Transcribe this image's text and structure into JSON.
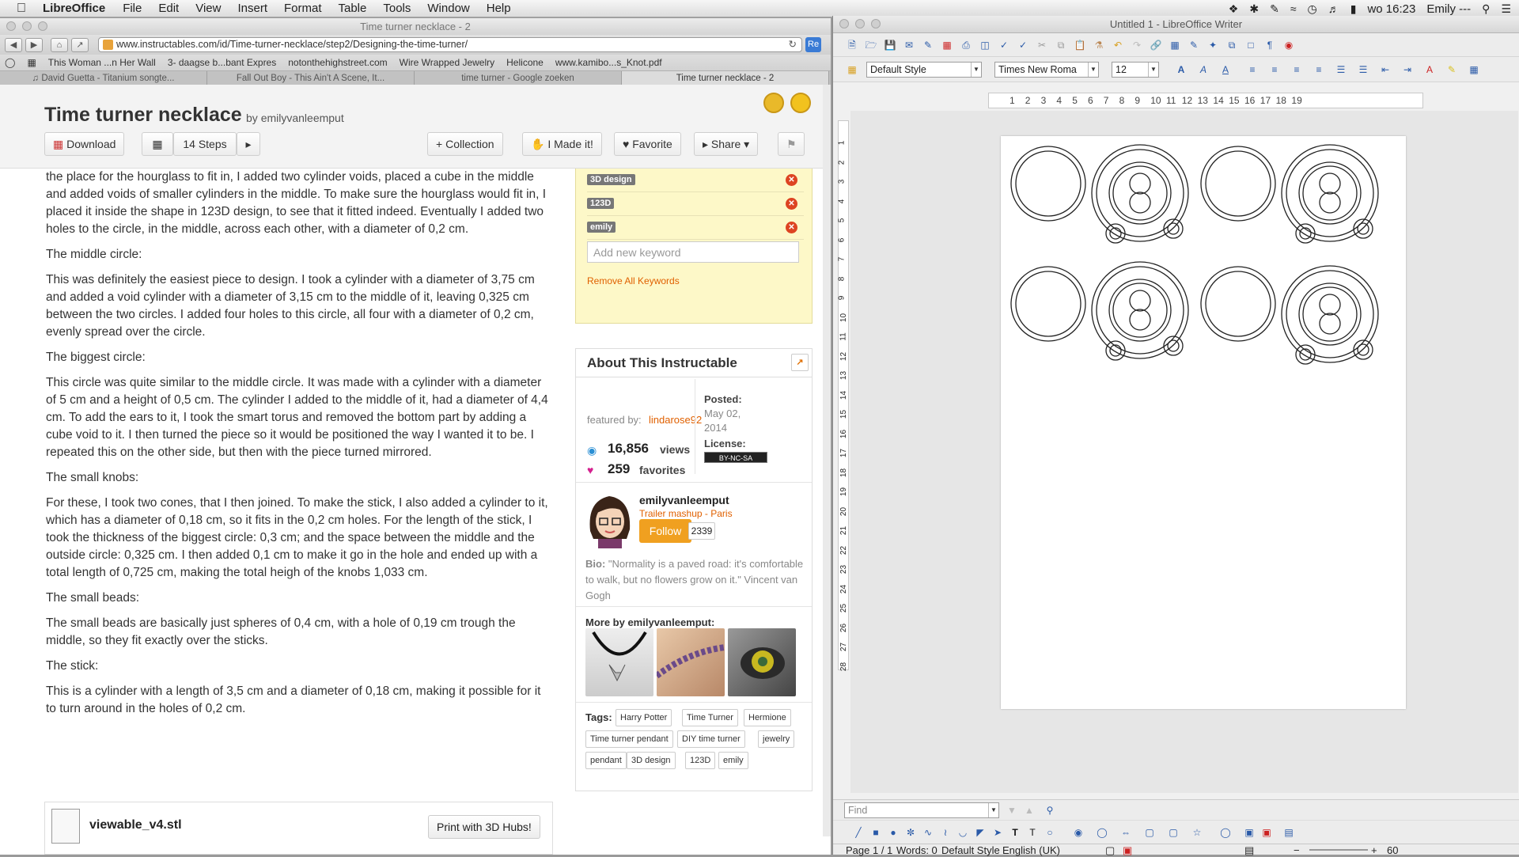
{
  "menubar": {
    "app": "LibreOffice",
    "items": [
      "File",
      "Edit",
      "View",
      "Insert",
      "Format",
      "Table",
      "Tools",
      "Window",
      "Help"
    ],
    "clock": "wo 16:23",
    "user": "Emily ---"
  },
  "browser": {
    "title": "Time turner necklace - 2",
    "url": "www.instructables.com/id/Time-turner-necklace/step2/Designing-the-time-turner/",
    "url_tail": "Re",
    "bookmarks": [
      "This Woman ...n Her Wall",
      "3- daagse b...bant Expres",
      "notonthehighstreet.com",
      "Wire Wrapped Jewelry",
      "Helicone",
      "www.kamibo...s_Knot.pdf"
    ],
    "tabs": [
      "David Guetta - Titanium songte...",
      "Fall Out Boy - This Ain't A Scene, It...",
      "time turner - Google zoeken",
      "Time turner necklace - 2"
    ]
  },
  "header": {
    "title": "Time turner necklace",
    "byline_prefix": "by",
    "author": "emilyvanleemput",
    "download": "Download",
    "steps": "14 Steps",
    "collection": "Collection",
    "made_it": "I Made it!",
    "favorite": "Favorite",
    "share": "Share"
  },
  "article": {
    "p1": "the place for the hourglass to fit in, I added two cylinder voids, placed a cube in the middle and added voids of smaller cylinders in the middle. To make sure the hourglass would fit in, I placed it inside the shape in 123D design, to see that it fitted indeed. Eventually I added two holes to the circle, in the middle, across each other, with a diameter of 0,2 cm.",
    "h2": "The middle circle:",
    "p2": "This was definitely the easiest piece to design. I took a cylinder with a diameter of 3,75 cm and added a void cylinder with a diameter of 3,15 cm to the middle of it, leaving 0,325 cm between the two circles. I added four holes to this circle, all four with a diameter of 0,2 cm, evenly spread over the circle.",
    "h3": "The biggest circle:",
    "p3": "This circle was quite similar to the middle circle. It was made with a cylinder with a diameter of 5 cm and a height of 0,5 cm. The cylinder I added to the middle of it, had a diameter of 4,4 cm. To add the ears to it, I took the smart torus and removed the bottom part by adding a cube void to it. I then turned the piece so it would be positioned the way I wanted it to be. I repeated this on the other side, but then with the piece turned mirrored.",
    "h4": "The small knobs:",
    "p4": "For these, I took two cones, that I then joined. To make the stick, I also added a cylinder to it, which has a diameter of 0,18 cm, so it fits in the 0,2 cm holes. For the length of the stick, I took the thickness of the biggest circle: 0,3 cm; and the space between the middle and the outside circle: 0,325 cm. I then added 0,1 cm to make it go in the hole and ended up with a total length of 0,725 cm, making the total heigh of the knobs 1,033 cm.",
    "h5": "The small beads:",
    "p5": "The small beads are basically just spheres of 0,4 cm, with a hole of 0,19 cm trough the middle, so they fit exactly over the sticks.",
    "h6": "The stick:",
    "p6": "This is a cylinder with a length of 3,5 cm and a diameter of 0,18 cm, making it possible for it to turn around in the holes of 0,2 cm."
  },
  "keywords": {
    "tags": [
      "3D design",
      "123D",
      "emily"
    ],
    "placeholder": "Add new keyword",
    "remove_all": "Remove All Keywords"
  },
  "about": {
    "title": "About This Instructable",
    "featured_label": "featured by:",
    "featured_by": "lindarose92",
    "posted_label": "Posted:",
    "posted_date_1": "May 02,",
    "posted_date_2": "2014",
    "license_label": "License:",
    "license_badge": "BY-NC-SA",
    "views": "16,856",
    "views_label": "views",
    "favorites": "259",
    "favorites_label": "favorites",
    "author": "emilyvanleemput",
    "author_sub": "Trailer mashup - Paris",
    "follow": "Follow",
    "followers": "2339",
    "bio_label": "Bio:",
    "bio": "\"Normality is a paved road: it's comfortable to walk, but no flowers grow on it.\" Vincent van Gogh",
    "more_by": "More by emilyvanleemput:",
    "tags_label": "Tags:",
    "tags": [
      "Harry Potter",
      "Time Turner",
      "Hermione",
      "Time turner pendant",
      "DIY time turner",
      "jewelry",
      "pendant",
      "3D design",
      "123D",
      "emily"
    ]
  },
  "download": {
    "file": "viewable_v4.stl",
    "print_button": "Print with 3D Hubs!"
  },
  "writer": {
    "title": "Untitled 1 - LibreOffice Writer",
    "style": "Default Style",
    "font": "Times New Roma",
    "size": "12",
    "ruler_nums": [
      "1",
      "2",
      "3",
      "4",
      "5",
      "6",
      "7",
      "8",
      "9",
      "10",
      "11",
      "12",
      "13",
      "14",
      "15",
      "16",
      "17",
      "18",
      "19"
    ],
    "vruler_nums": [
      "1",
      "2",
      "3",
      "4",
      "5",
      "6",
      "7",
      "8",
      "9",
      "10",
      "11",
      "12",
      "13",
      "14",
      "15",
      "16",
      "17",
      "18",
      "19",
      "20",
      "21",
      "22",
      "23",
      "24",
      "25",
      "26",
      "27",
      "28"
    ],
    "find_placeholder": "Find",
    "status_page": "Page 1 / 1",
    "status_words": "Words: 0",
    "status_style": "Default Style",
    "status_lang": "English (UK)",
    "zoom": "60"
  }
}
